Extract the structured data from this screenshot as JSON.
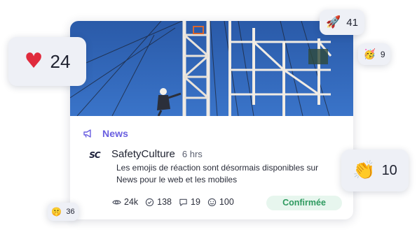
{
  "card": {
    "image_description": "photo of worker climbing a drilling rig",
    "channel": "News",
    "author": "SafetyCulture",
    "author_logo_text": "SC",
    "time": "6 hrs",
    "body": "Les emojis de réaction sont désormais disponibles sur News pour le web et les mobiles",
    "stats": {
      "views": "24k",
      "reads": "138",
      "comments": "19",
      "reactions": "100"
    },
    "status": "Confirmée"
  },
  "reactions": {
    "heart": {
      "icon": "red-heart-icon",
      "emoji": "♥",
      "count": "24"
    },
    "rocket": {
      "icon": "rocket-icon",
      "emoji": "🚀",
      "count": "41"
    },
    "party": {
      "icon": "partying-face-icon",
      "emoji": "🥳",
      "count": "9"
    },
    "clap": {
      "icon": "clapping-hands-icon",
      "emoji": "👏",
      "count": "10"
    },
    "shh": {
      "icon": "shushing-face-icon",
      "emoji": "🤫",
      "count": "36"
    }
  },
  "colors": {
    "accent": "#6a5fe0",
    "status_text": "#2e9a5f",
    "status_bg": "#e7f6ee",
    "heart": "#e02a3c",
    "sky": "#2f63b8"
  }
}
